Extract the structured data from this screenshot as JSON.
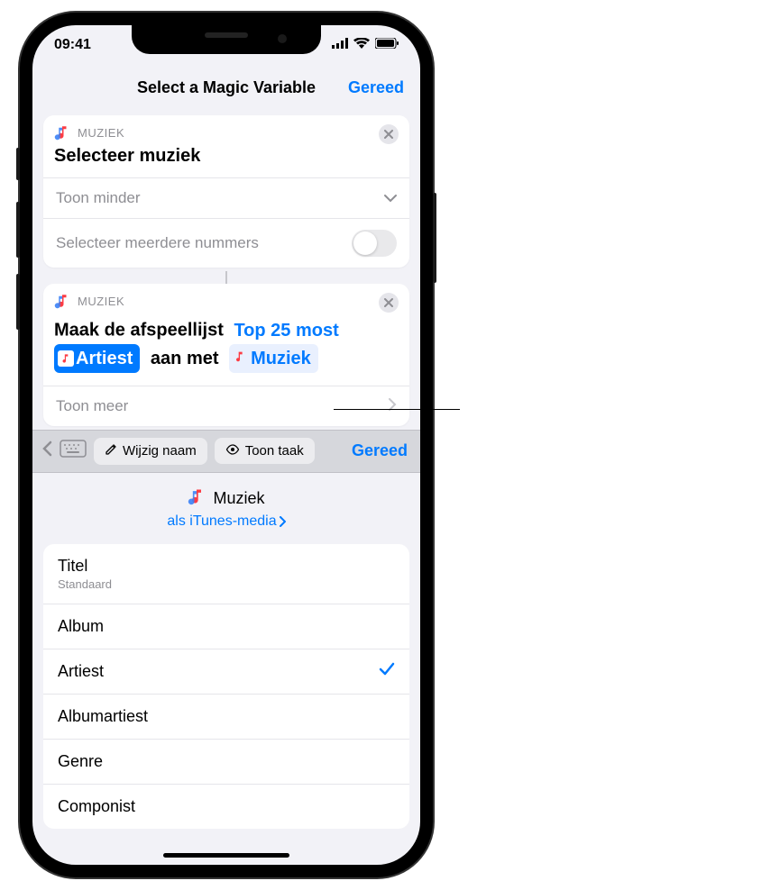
{
  "status": {
    "time": "09:41"
  },
  "nav": {
    "title": "Select a Magic Variable",
    "done": "Gereed"
  },
  "card1": {
    "app": "MUZIEK",
    "title": "Selecteer muziek",
    "showLess": "Toon minder",
    "multi": "Selecteer meerdere nummers"
  },
  "card2": {
    "app": "MUZIEK",
    "text1": "Maak de afspeellijst",
    "token1": "Top 25 most",
    "pillArtist": "Artiest",
    "text2": "aan met",
    "pillMuziek": "Muziek",
    "showMore": "Toon meer"
  },
  "toolbar": {
    "rename": "Wijzig naam",
    "showTask": "Toon taak",
    "done": "Gereed"
  },
  "varHeader": {
    "title": "Muziek",
    "asLink": "als iTunes-media"
  },
  "properties": [
    {
      "label": "Titel",
      "sub": "Standaard",
      "checked": false
    },
    {
      "label": "Album",
      "sub": "",
      "checked": false
    },
    {
      "label": "Artiest",
      "sub": "",
      "checked": true
    },
    {
      "label": "Albumartiest",
      "sub": "",
      "checked": false
    },
    {
      "label": "Genre",
      "sub": "",
      "checked": false
    },
    {
      "label": "Componist",
      "sub": "",
      "checked": false
    }
  ],
  "colors": {
    "accent": "#007aff"
  }
}
